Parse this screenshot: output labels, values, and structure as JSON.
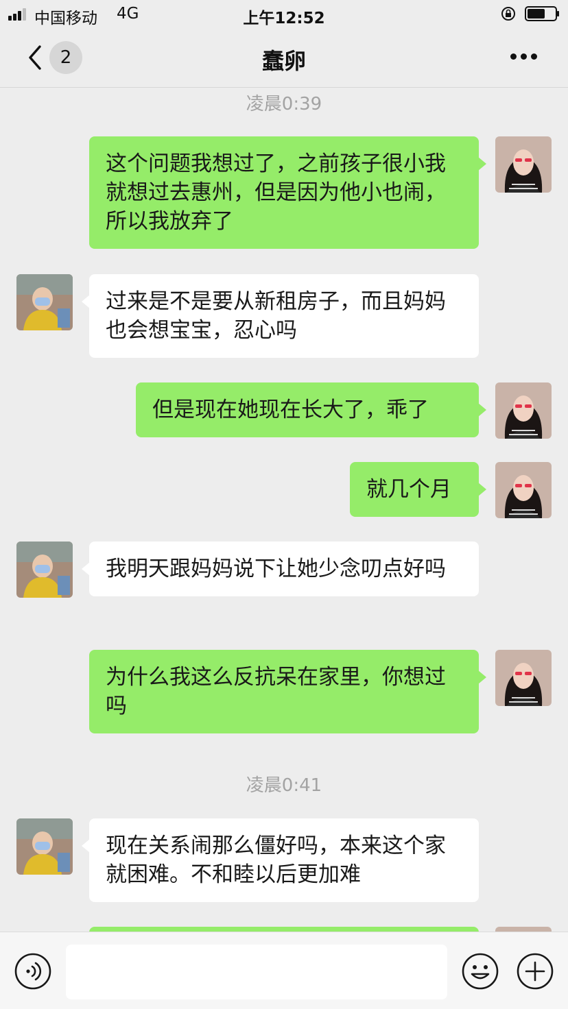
{
  "status": {
    "carrier": "中国移动",
    "network": "4G",
    "time": "上午12:52",
    "icons": [
      "signal-icon",
      "rotation-lock-icon",
      "battery-icon"
    ]
  },
  "nav": {
    "title": "蠢卵",
    "unread_count": "2",
    "icons": [
      "back-chevron-icon",
      "more-dots-icon"
    ]
  },
  "chat": {
    "timestamps": [
      "凌晨0:39",
      "凌晨0:41"
    ],
    "messages": [
      {
        "side": "right",
        "text": "这个问题我想过了，之前孩子很小我就想过去惠州，但是因为他小也闹，所以我放弃了"
      },
      {
        "side": "left",
        "text": "过来是不是要从新租房子，而且妈妈也会想宝宝，忍心吗"
      },
      {
        "side": "right",
        "text": "但是现在她现在长大了，乖了"
      },
      {
        "side": "right",
        "text": "就几个月"
      },
      {
        "side": "left",
        "text": "我明天跟妈妈说下让她少念叨点好吗"
      },
      {
        "side": "right",
        "text": "为什么我这么反抗呆在家里，你想过吗"
      },
      {
        "side": "left",
        "text": "现在关系闹那么僵好吗，本来这个家就困难。不和睦以后更加难"
      }
    ]
  },
  "input": {
    "value": "",
    "icons": [
      "voice-icon",
      "emoji-icon",
      "plus-icon"
    ]
  },
  "colors": {
    "background": "#ededed",
    "outgoing_bubble": "#95ec69",
    "incoming_bubble": "#ffffff",
    "timestamp_text": "#a3a3a3"
  }
}
